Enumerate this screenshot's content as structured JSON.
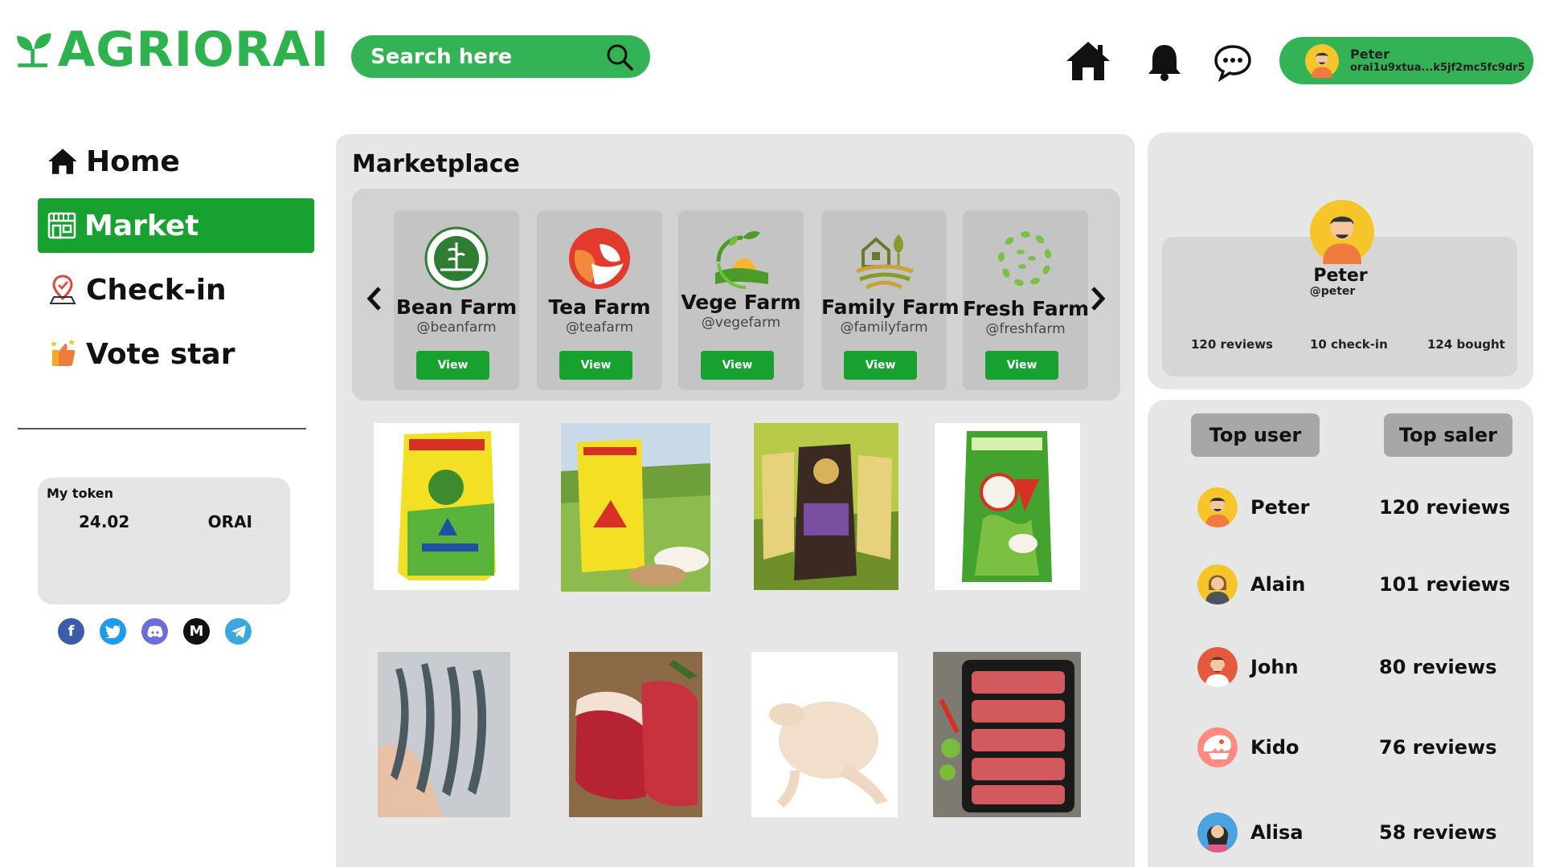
{
  "header": {
    "brand": "AGRIORAI",
    "search_placeholder": "Search here",
    "user": {
      "name": "Peter",
      "address": "orai1u9xtua...k5jf2mc5fc9dr5"
    }
  },
  "sidebar": {
    "items": [
      {
        "label": "Home",
        "icon": "home-icon",
        "active": false
      },
      {
        "label": "Market",
        "icon": "store-icon",
        "active": true
      },
      {
        "label": "Check-in",
        "icon": "map-pin-icon",
        "active": false
      },
      {
        "label": "Vote star",
        "icon": "star-icon",
        "active": false
      }
    ],
    "token": {
      "label": "My token",
      "amount": "24.02",
      "symbol": "ORAI"
    },
    "socials": [
      "facebook-icon",
      "twitter-icon",
      "discord-icon",
      "medium-icon",
      "telegram-icon"
    ]
  },
  "marketplace": {
    "title": "Marketplace",
    "view_label": "View",
    "farms": [
      {
        "name": "Bean Farm",
        "handle": "@beanfarm"
      },
      {
        "name": "Tea Farm",
        "handle": "@teafarm"
      },
      {
        "name": "Vege Farm",
        "handle": "@vegefarm"
      },
      {
        "name": "Family Farm",
        "handle": "@familyfarm"
      },
      {
        "name": "Fresh Farm",
        "handle": "@freshfarm"
      }
    ],
    "products": [
      "rice-bag-yellow",
      "rice-bag-field",
      "rice-bag-clean-food",
      "rice-bag-green",
      "shrimp",
      "beef-steak",
      "whole-chicken",
      "sliced-beef-tray"
    ]
  },
  "profile": {
    "name": "Peter",
    "handle": "@peter",
    "reviews": "120 reviews",
    "checkins": "10 check-in",
    "bought": "124 bought"
  },
  "ranking": {
    "tabs": [
      "Top user",
      "Top saler"
    ],
    "users": [
      {
        "name": "Peter",
        "reviews": "120 reviews"
      },
      {
        "name": "Alain",
        "reviews": "101 reviews"
      },
      {
        "name": "John",
        "reviews": "80 reviews"
      },
      {
        "name": "Kido",
        "reviews": "76 reviews"
      },
      {
        "name": "Alisa",
        "reviews": "58 reviews"
      }
    ]
  },
  "colors": {
    "brand_green": "#2db24e",
    "active_green": "#17a12f",
    "panel_gray": "#e6e6e6"
  }
}
